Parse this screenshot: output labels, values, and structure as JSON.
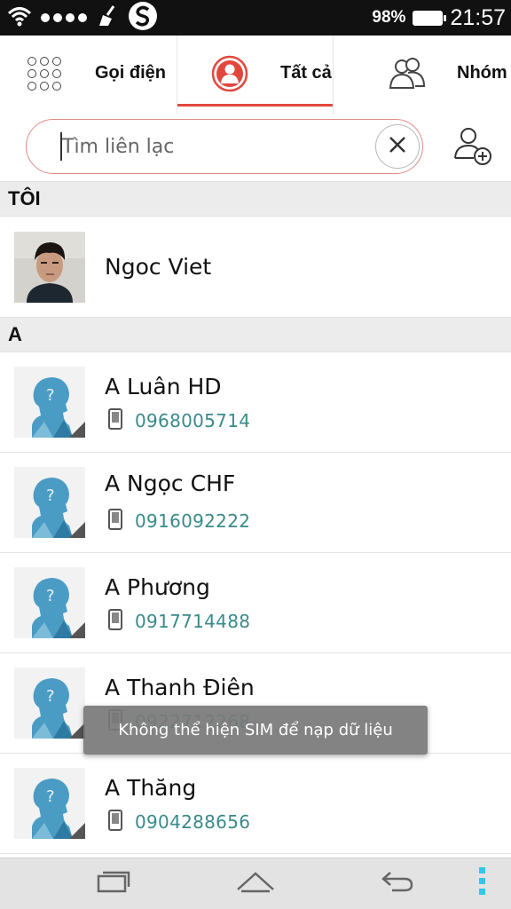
{
  "status_bar": {
    "battery_percent": "98%",
    "time": "21:57"
  },
  "tabs": {
    "call_label": "Gọi điện",
    "all_label": "Tất cả",
    "group_label": "Nhóm",
    "active": "all",
    "accent_color": "#e2473d"
  },
  "search": {
    "placeholder": "Tìm liên lạc",
    "value": ""
  },
  "sections": {
    "me": "TÔI",
    "a": "A"
  },
  "me": {
    "name": "Ngoc Viet"
  },
  "contacts": [
    {
      "name": "A Luân HD",
      "phone": "0968005714"
    },
    {
      "name": "A Ngọc CHF",
      "phone": "0916092222"
    },
    {
      "name": "A Phương",
      "phone": "0917714488"
    },
    {
      "name": "A Thanh Điên",
      "phone": "0922712268"
    },
    {
      "name": "A Thăng",
      "phone": "0904288656"
    }
  ],
  "toast": {
    "message": "Không thể hiện SIM để nạp dữ liệu"
  },
  "icons": {
    "wifi": "wifi-icon",
    "signal": "signal-dots-icon",
    "cleaner": "broom-icon",
    "app": "s-logo-icon",
    "battery": "battery-icon",
    "keypad": "keypad-icon",
    "person": "person-icon",
    "group": "group-icon",
    "clear": "close-icon",
    "add_contact": "add-contact-icon",
    "phone": "mobile-phone-icon",
    "recents": "recent-apps-icon",
    "home": "home-icon",
    "back": "back-icon",
    "menu": "menu-icon"
  }
}
